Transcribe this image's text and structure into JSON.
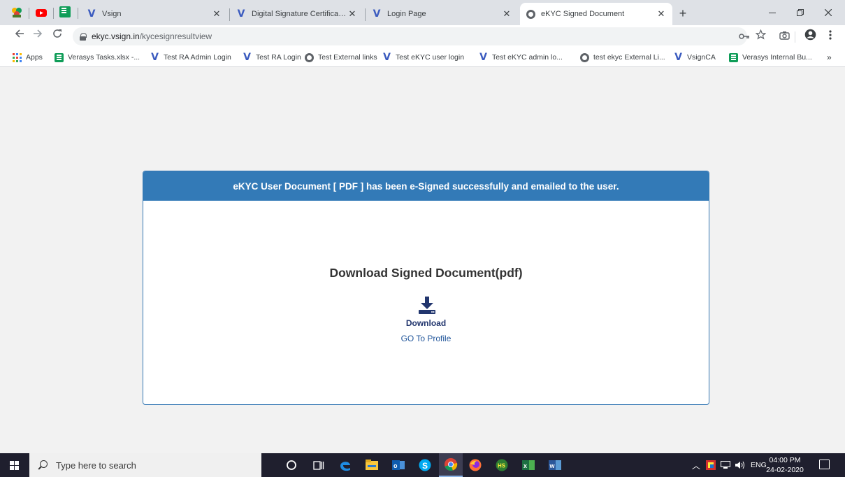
{
  "browser": {
    "tabs": [
      {
        "title": "Vsign",
        "icon": "vsign-logo-icon"
      },
      {
        "title": "Digital Signature Certificate Servi",
        "icon": "vsign-logo-icon"
      },
      {
        "title": "Login Page",
        "icon": "vsign-logo-icon"
      },
      {
        "title": "eKYC Signed Document",
        "icon": "globe-icon"
      }
    ],
    "new_tab_label": "+",
    "url_host": "ekyc.vsign.in",
    "url_path": "/kycesignresultview",
    "bookmarks": [
      {
        "label": "Apps",
        "icon": "apps-grid-icon"
      },
      {
        "label": "Verasys Tasks.xlsx -...",
        "icon": "sheets-icon"
      },
      {
        "label": "Test RA Admin Login",
        "icon": "vsign-logo-icon"
      },
      {
        "label": "Test RA Login",
        "icon": "vsign-logo-icon"
      },
      {
        "label": "Test External links",
        "icon": "globe-icon"
      },
      {
        "label": "Test eKYC user login",
        "icon": "vsign-logo-icon"
      },
      {
        "label": "Test eKYC admin lo...",
        "icon": "vsign-logo-icon"
      },
      {
        "label": "test ekyc External Li...",
        "icon": "globe-icon"
      },
      {
        "label": "VsignCA",
        "icon": "vsign-logo-icon"
      },
      {
        "label": "Verasys Internal Bu...",
        "icon": "sheets-icon"
      }
    ],
    "more_bookmarks": "»"
  },
  "page": {
    "banner": "eKYC User Document [ PDF ] has been e-Signed successfully and emailed to the user.",
    "download_title": "Download Signed Document(pdf)",
    "download_link": "Download",
    "profile_link": "GO To Profile",
    "accent_color": "#337ab7"
  },
  "taskbar": {
    "search_placeholder": "Type here to search",
    "language": "ENG",
    "time": "04:00 PM",
    "date": "24-02-2020"
  }
}
